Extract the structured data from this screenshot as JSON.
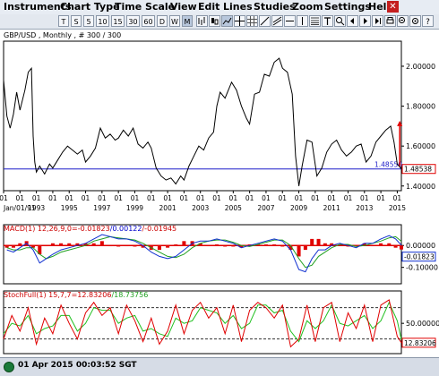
{
  "menu": [
    "Instruments",
    "Chart Type",
    "Time Scale",
    "View",
    "Edit",
    "Lines",
    "Studies",
    "Zoom",
    "Settings",
    "Help"
  ],
  "toolbar": {
    "buttons": [
      "T",
      "S",
      "5",
      "10",
      "15",
      "30",
      "60",
      "D",
      "W",
      "M"
    ],
    "active": "M"
  },
  "price_panel": {
    "title": "GBP/USD , Monthly , # 300 / 300",
    "y_ticks": [
      "2.00000",
      "1.80000",
      "1.60000",
      "1.40000"
    ],
    "y_tick_values": [
      2.0,
      1.8,
      1.6,
      1.4
    ],
    "ylim": [
      1.3765,
      2.1255
    ],
    "horizontal_line_label": "1.48550",
    "horizontal_line_value": 1.4855,
    "last_price_label": "1.48538",
    "last_price_value": 1.48538,
    "year_label_row_top": [
      "01",
      "01",
      "01",
      "01",
      "01",
      "01",
      "01",
      "01",
      "01",
      "01",
      "01",
      "01",
      "01",
      "01",
      "01",
      "01",
      "01",
      "01",
      "01",
      "01",
      "01",
      "01",
      "01",
      "01",
      "01"
    ],
    "year_label_row_bottom": [
      "Jan/01/91",
      "1993",
      "1995",
      "1997",
      "1999",
      "2001",
      "2003",
      "2005",
      "2007",
      "2009",
      "2011",
      "2013",
      "2015"
    ],
    "colors": {
      "price": "#000000",
      "hline": "#1c1cc8",
      "arrow": "#e00000",
      "last_box": "#e00000"
    }
  },
  "macd_panel": {
    "title_parts": [
      {
        "text": "MACD(1) 12,26,9,0=-0.01823",
        "color": "#cc0000"
      },
      {
        "text": "/0.00122",
        "color": "#0000cc"
      },
      {
        "text": "/-0.01945",
        "color": "#cc0000"
      }
    ],
    "y_ticks": [
      "0.00000",
      "-0.10000"
    ],
    "y_tick_values": [
      0.0,
      -0.1
    ],
    "ylim": [
      -0.175,
      0.095
    ],
    "last_value_label": "-0.01823",
    "colors": {
      "histogram": "#e00000",
      "macd": "#1030d0",
      "signal": "#20a020"
    }
  },
  "stoch_panel": {
    "title_parts": [
      {
        "text": "StochFull(1) 15,7,7=12.83206",
        "color": "#cc0000"
      },
      {
        "text": "/18.73756",
        "color": "#20a020"
      }
    ],
    "y_ticks": [
      "50.00000"
    ],
    "y_tick_values": [
      50
    ],
    "ylim": [
      -8,
      112
    ],
    "overbought": 80,
    "oversold": 20,
    "last_value_label": "12.83206",
    "colors": {
      "k": "#e00000",
      "d": "#20c020",
      "bands": "#333333"
    }
  },
  "chart_data": [
    {
      "type": "line",
      "title": "GBP/USD , Monthly , # 300 / 300",
      "x_range": [
        1991,
        2015.25
      ],
      "x_ticks": [
        1993,
        1995,
        1997,
        1999,
        2001,
        2003,
        2005,
        2007,
        2009,
        2011,
        2013,
        2015
      ],
      "series": [
        {
          "x": [
            1991.0,
            1991.2,
            1991.4,
            1991.6,
            1991.8,
            1992.0,
            1992.3,
            1992.5,
            1992.7,
            1992.8,
            1992.9,
            1993.0,
            1993.2,
            1993.5,
            1993.8,
            1994.0,
            1994.3,
            1994.6,
            1994.9,
            1995.2,
            1995.5,
            1995.8,
            1996.0,
            1996.3,
            1996.6,
            1996.9,
            1997.2,
            1997.5,
            1997.8,
            1998.0,
            1998.3,
            1998.6,
            1998.9,
            1999.2,
            1999.5,
            1999.8,
            2000.0,
            2000.3,
            2000.6,
            2000.9,
            2001.2,
            2001.5,
            2001.8,
            2002.0,
            2002.3,
            2002.6,
            2002.9,
            2003.2,
            2003.5,
            2003.8,
            2004.0,
            2004.2,
            2004.5,
            2004.9,
            2005.2,
            2005.5,
            2005.8,
            2006.0,
            2006.3,
            2006.6,
            2006.9,
            2007.2,
            2007.5,
            2007.8,
            2008.0,
            2008.3,
            2008.6,
            2008.8,
            2009.0,
            2009.2,
            2009.5,
            2009.8,
            2010.1,
            2010.4,
            2010.7,
            2011.0,
            2011.3,
            2011.6,
            2011.9,
            2012.2,
            2012.5,
            2012.8,
            2013.1,
            2013.4,
            2013.7,
            2014.0,
            2014.3,
            2014.6,
            2014.8,
            2015.0,
            2015.25
          ],
          "values": [
            1.93,
            1.75,
            1.69,
            1.76,
            1.87,
            1.78,
            1.88,
            1.97,
            1.99,
            1.65,
            1.52,
            1.47,
            1.5,
            1.46,
            1.51,
            1.49,
            1.53,
            1.57,
            1.6,
            1.58,
            1.56,
            1.58,
            1.52,
            1.55,
            1.59,
            1.69,
            1.64,
            1.66,
            1.63,
            1.64,
            1.68,
            1.65,
            1.69,
            1.61,
            1.59,
            1.62,
            1.59,
            1.49,
            1.45,
            1.43,
            1.44,
            1.41,
            1.45,
            1.43,
            1.5,
            1.55,
            1.6,
            1.58,
            1.64,
            1.67,
            1.8,
            1.87,
            1.84,
            1.92,
            1.88,
            1.8,
            1.74,
            1.71,
            1.86,
            1.87,
            1.96,
            1.95,
            2.02,
            2.04,
            1.99,
            1.97,
            1.86,
            1.55,
            1.4,
            1.5,
            1.63,
            1.62,
            1.45,
            1.49,
            1.57,
            1.61,
            1.63,
            1.58,
            1.55,
            1.57,
            1.6,
            1.61,
            1.52,
            1.55,
            1.62,
            1.65,
            1.68,
            1.7,
            1.62,
            1.51,
            1.4854
          ]
        }
      ]
    },
    {
      "type": "line",
      "title": "MACD(1) 12,26,9,0",
      "series": [
        {
          "name": "MACD",
          "x": [
            1991.2,
            1991.6,
            1992.0,
            1992.4,
            1992.8,
            1993.2,
            1993.6,
            1994.0,
            1994.5,
            1995.0,
            1995.5,
            1996.0,
            1996.5,
            1997.0,
            1997.5,
            1998.0,
            1998.5,
            1999.0,
            1999.5,
            2000.0,
            2000.5,
            2001.0,
            2001.5,
            2002.0,
            2002.5,
            2003.0,
            2003.5,
            2004.0,
            2004.5,
            2005.0,
            2005.5,
            2006.0,
            2006.5,
            2007.0,
            2007.5,
            2008.0,
            2008.5,
            2009.0,
            2009.4,
            2009.8,
            2010.2,
            2010.6,
            2011.0,
            2011.5,
            2012.0,
            2012.5,
            2013.0,
            2013.5,
            2014.0,
            2014.5,
            2014.9,
            2015.25
          ],
          "values": [
            -0.02,
            -0.03,
            -0.01,
            0.01,
            -0.02,
            -0.08,
            -0.06,
            -0.04,
            -0.02,
            -0.01,
            0.0,
            0.01,
            0.03,
            0.05,
            0.04,
            0.03,
            0.03,
            0.02,
            0.0,
            -0.03,
            -0.05,
            -0.06,
            -0.05,
            -0.02,
            0.01,
            0.02,
            0.02,
            0.03,
            0.02,
            0.01,
            -0.01,
            0.0,
            0.01,
            0.02,
            0.03,
            0.02,
            -0.02,
            -0.11,
            -0.12,
            -0.06,
            -0.02,
            -0.02,
            0.0,
            0.01,
            0.0,
            -0.01,
            0.01,
            0.01,
            0.03,
            0.045,
            0.03,
            0.00122
          ]
        },
        {
          "name": "Signal",
          "x": [
            1991.2,
            1991.6,
            1992.0,
            1992.4,
            1992.8,
            1993.2,
            1993.6,
            1994.0,
            1994.5,
            1995.0,
            1995.5,
            1996.0,
            1996.5,
            1997.0,
            1997.5,
            1998.0,
            1998.5,
            1999.0,
            1999.5,
            2000.0,
            2000.5,
            2001.0,
            2001.5,
            2002.0,
            2002.5,
            2003.0,
            2003.5,
            2004.0,
            2004.5,
            2005.0,
            2005.5,
            2006.0,
            2006.5,
            2007.0,
            2007.5,
            2008.0,
            2008.5,
            2009.0,
            2009.4,
            2009.8,
            2010.2,
            2010.6,
            2011.0,
            2011.5,
            2012.0,
            2012.5,
            2013.0,
            2013.5,
            2014.0,
            2014.5,
            2014.9,
            2015.25
          ],
          "values": [
            -0.01,
            -0.02,
            -0.02,
            -0.01,
            -0.01,
            -0.04,
            -0.06,
            -0.05,
            -0.03,
            -0.02,
            -0.01,
            0.0,
            0.02,
            0.03,
            0.04,
            0.035,
            0.03,
            0.025,
            0.01,
            -0.01,
            -0.03,
            -0.05,
            -0.055,
            -0.04,
            -0.01,
            0.01,
            0.02,
            0.025,
            0.025,
            0.015,
            0.0,
            -0.005,
            0.005,
            0.015,
            0.025,
            0.025,
            0.0,
            -0.06,
            -0.1,
            -0.09,
            -0.05,
            -0.03,
            -0.01,
            0.005,
            0.005,
            -0.005,
            0.0,
            0.01,
            0.02,
            0.035,
            0.04,
            0.01945
          ]
        }
      ]
    },
    {
      "type": "line",
      "title": "StochFull(1) 15,7,7",
      "series": [
        {
          "name": "%K",
          "x": [
            1991.0,
            1991.5,
            1992.0,
            1992.5,
            1993.0,
            1993.5,
            1994.0,
            1994.5,
            1995.0,
            1995.5,
            1996.0,
            1996.5,
            1997.0,
            1997.5,
            1998.0,
            1998.5,
            1999.0,
            1999.5,
            2000.0,
            2000.5,
            2001.0,
            2001.5,
            2002.0,
            2002.5,
            2003.0,
            2003.5,
            2004.0,
            2004.5,
            2005.0,
            2005.5,
            2006.0,
            2006.5,
            2007.0,
            2007.5,
            2008.0,
            2008.5,
            2009.0,
            2009.5,
            2010.0,
            2010.5,
            2011.0,
            2011.5,
            2012.0,
            2012.5,
            2013.0,
            2013.5,
            2014.0,
            2014.5,
            2015.0,
            2015.25
          ],
          "values": [
            20,
            65,
            35,
            80,
            10,
            60,
            30,
            85,
            50,
            20,
            70,
            90,
            65,
            80,
            30,
            85,
            55,
            15,
            60,
            10,
            35,
            85,
            30,
            75,
            90,
            60,
            80,
            30,
            85,
            15,
            75,
            90,
            80,
            60,
            85,
            5,
            20,
            85,
            15,
            80,
            90,
            15,
            70,
            40,
            85,
            15,
            85,
            95,
            25,
            12.83
          ]
        },
        {
          "name": "%D",
          "x": [
            1991.0,
            1991.5,
            1992.0,
            1992.5,
            1993.0,
            1993.5,
            1994.0,
            1994.5,
            1995.0,
            1995.5,
            1996.0,
            1996.5,
            1997.0,
            1997.5,
            1998.0,
            1998.5,
            1999.0,
            1999.5,
            2000.0,
            2000.5,
            2001.0,
            2001.5,
            2002.0,
            2002.5,
            2003.0,
            2003.5,
            2004.0,
            2004.5,
            2005.0,
            2005.5,
            2006.0,
            2006.5,
            2007.0,
            2007.5,
            2008.0,
            2008.5,
            2009.0,
            2009.5,
            2010.0,
            2010.5,
            2011.0,
            2011.5,
            2012.0,
            2012.5,
            2013.0,
            2013.5,
            2014.0,
            2014.5,
            2015.0,
            2015.25
          ],
          "values": [
            30,
            50,
            45,
            65,
            30,
            40,
            45,
            65,
            65,
            35,
            50,
            80,
            75,
            75,
            50,
            60,
            65,
            35,
            40,
            30,
            25,
            60,
            50,
            55,
            80,
            75,
            70,
            50,
            65,
            40,
            50,
            85,
            85,
            70,
            75,
            35,
            15,
            55,
            40,
            55,
            85,
            50,
            45,
            55,
            65,
            40,
            55,
            90,
            55,
            18.74
          ]
        }
      ]
    }
  ],
  "status": {
    "datetime": "01 Apr 2015 00:03:52 SGT"
  }
}
